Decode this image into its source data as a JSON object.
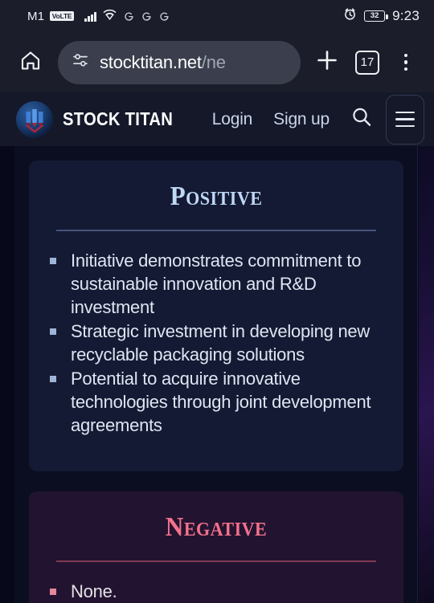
{
  "status_bar": {
    "carrier": "M1",
    "volte_badge": "VoLTE",
    "network_icons": [
      "signal-bars-icon",
      "wifi-icon",
      "g-network-icon",
      "g-network-icon",
      "g-network-icon"
    ],
    "alarm_icon": "alarm-clock-icon",
    "battery_level": "32",
    "time": "9:23"
  },
  "browser": {
    "home_icon": "home-icon",
    "url_main": "stocktitan.net",
    "url_path": "/ne",
    "site_settings_icon": "site-settings-icon",
    "new_tab_icon": "plus-icon",
    "tab_count": "17",
    "menu_icon": "three-dots-menu-icon"
  },
  "site_header": {
    "logo_icon": "stock-titan-logo-icon",
    "brand": "STOCK TITAN",
    "links": [
      {
        "label": "Login"
      },
      {
        "label": "Sign up"
      }
    ],
    "search_icon": "search-icon",
    "menu_icon": "hamburger-menu-icon"
  },
  "content": {
    "cards": [
      {
        "id": "positive",
        "title": "Positive",
        "title_color": "#bfd8f5",
        "bullet_color": "#9fb4d6",
        "items": [
          "Initiative demonstrates commitment to sustainable innovation and R&D investment",
          "Strategic investment in developing new recyclable packaging solutions",
          "Potential to acquire innovative technologies through joint development agreements"
        ]
      },
      {
        "id": "negative",
        "title": "Negative",
        "title_color": "#f4718c",
        "bullet_color": "#e4879f",
        "items": [
          "None."
        ]
      }
    ]
  }
}
